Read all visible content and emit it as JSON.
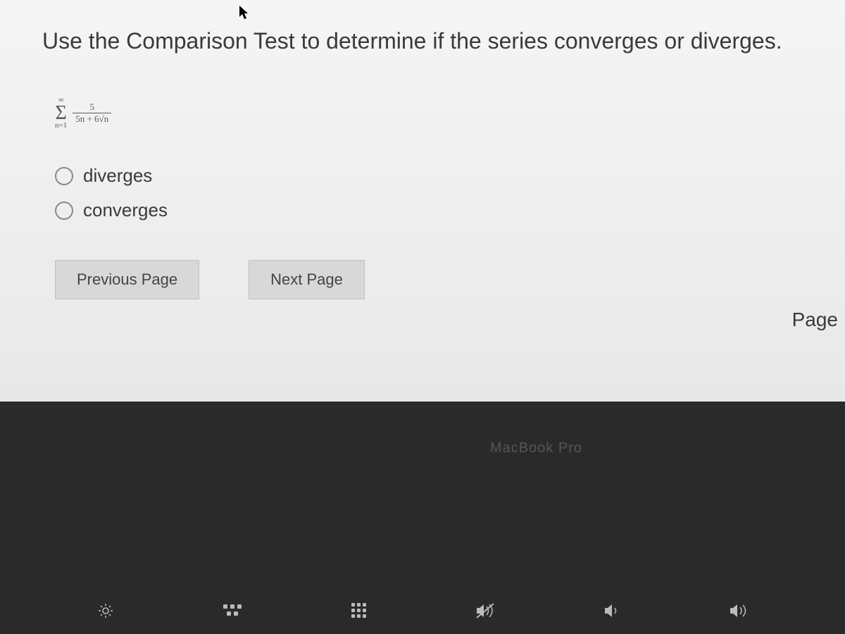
{
  "question": {
    "prompt": "Use the Comparison Test to determine if the series converges or diverges.",
    "formula": {
      "sigma_upper": "∞",
      "sigma_lower": "n=1",
      "numerator": "5",
      "denominator": "5n + 6√n"
    },
    "options": [
      {
        "label": "diverges"
      },
      {
        "label": "converges"
      }
    ]
  },
  "navigation": {
    "prev_label": "Previous Page",
    "next_label": "Next Page",
    "page_label": "Page"
  },
  "device": {
    "label": "MacBook Pro"
  },
  "media_keys": {
    "brightness_up": "brightness-up",
    "mission_control": "mission-control",
    "launchpad": "launchpad",
    "mute": "mute",
    "volume_down": "volume-down",
    "volume_up": "volume-up"
  }
}
